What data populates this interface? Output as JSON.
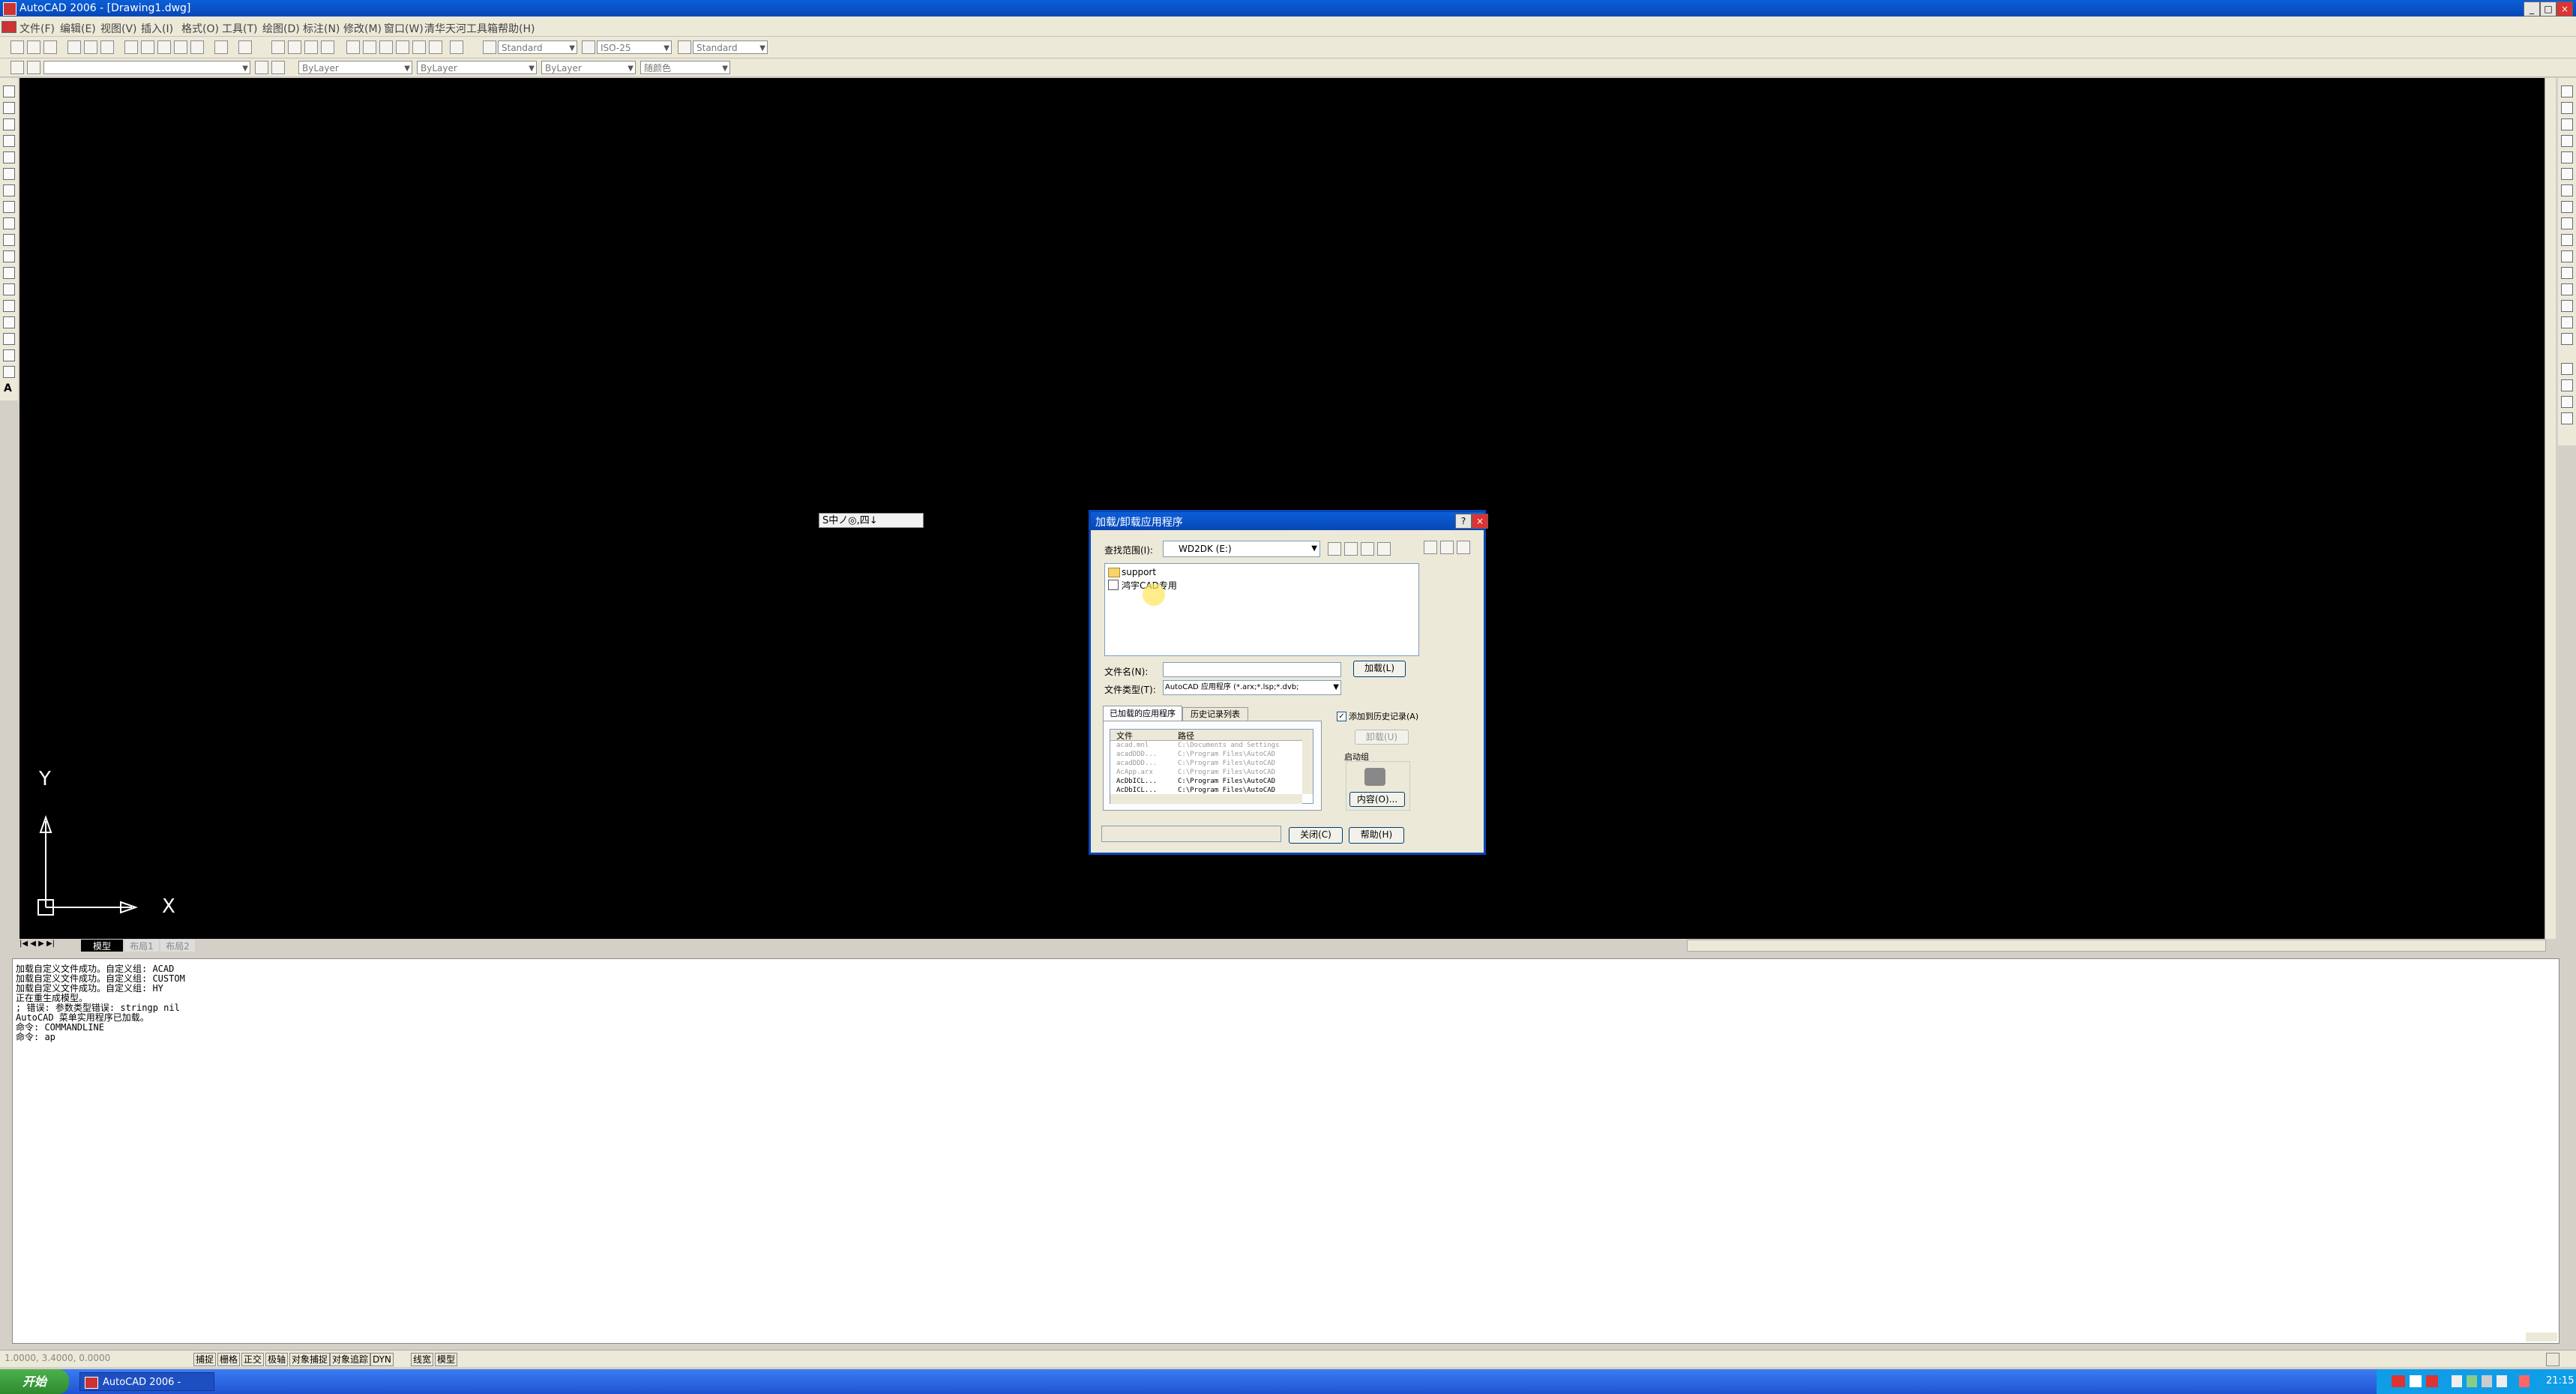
{
  "app": {
    "title": "AutoCAD 2006 - [Drawing1.dwg]",
    "window_buttons": [
      "_",
      "□",
      "×"
    ]
  },
  "menu": [
    "文件(F)",
    "编辑(E)",
    "视图(V)",
    "插入(I)",
    "格式(O)",
    "工具(T)",
    "绘图(D)",
    "标注(N)",
    "修改(M)",
    "窗口(W)",
    "清华天河工具箱",
    "帮助(H)"
  ],
  "toolbar": {
    "text_style": "Standard",
    "dim_style": "ISO-25",
    "table_style": "Standard",
    "layer": "ByLayer",
    "linetype": "ByLayer",
    "lineweight": "ByLayer",
    "plotstyle": "随颜色"
  },
  "ucs": {
    "x_label": "X",
    "y_label": "Y"
  },
  "layout_tabs": [
    "模型",
    "布局1",
    "布局2"
  ],
  "ime_bar": "S中ノ◎,四↓",
  "dialog": {
    "title": "加载/卸载应用程序",
    "help_btn": "?",
    "close_x": "×",
    "lookin_label": "查找范围(I):",
    "lookin_value": "WD2DK (E:)",
    "files": [
      {
        "icon": "folder-icon",
        "name": "support"
      },
      {
        "icon": "doc-icon",
        "name": "鸿宇CAD专用"
      }
    ],
    "filename_label": "文件名(N):",
    "filename_value": "",
    "filetype_label": "文件类型(T):",
    "filetype_value": "AutoCAD 应用程序 (*.arx;*.lsp;*.dvb;",
    "load_button": "加载(L)",
    "tab_loaded": "已加载的应用程序",
    "tab_history": "历史记录列表",
    "add_history_label": "添加到历史记录(A)",
    "col_file": "文件",
    "col_path": "路径",
    "rows": [
      {
        "file": "acad.mnl",
        "path": "C:\\Documents and Settings",
        "active": false
      },
      {
        "file": "acadDDD...",
        "path": "C:\\Program Files\\AutoCAD",
        "active": false
      },
      {
        "file": "acadDDD...",
        "path": "C:\\Program Files\\AutoCAD",
        "active": false
      },
      {
        "file": "AcApp.arx",
        "path": "C:\\Program Files\\AutoCAD",
        "active": false
      },
      {
        "file": "AcDbICL...",
        "path": "C:\\Program Files\\AutoCAD",
        "active": true
      },
      {
        "file": "AcDbICL...",
        "path": "C:\\Program Files\\AutoCAD",
        "active": true
      }
    ],
    "unload_button": "卸载(U)",
    "startup_label": "启动组",
    "contents_button": "内容(O)...",
    "close_button": "关闭(C)",
    "help_button": "帮助(H)"
  },
  "command_lines": [
    "加载自定义文件成功。自定义组: ACAD",
    "加载自定义文件成功。自定义组: CUSTOM",
    "加载自定义文件成功。自定义组: HY",
    "正在重生成模型。",
    "; 错误: 参数类型错误: stringp nil",
    "AutoCAD 菜单实用程序已加载。",
    "命令: COMMANDLINE",
    "命令: ap"
  ],
  "status": {
    "coords": "1.0000, 3.4000, 0.0000",
    "buttons": [
      "捕捉",
      "栅格",
      "正交",
      "极轴",
      "对象捕捉",
      "对象追踪",
      "DYN",
      "线宽",
      "模型"
    ]
  },
  "taskbar": {
    "start": "开始",
    "item": "AutoCAD 2006 -",
    "clock": "21:15"
  }
}
